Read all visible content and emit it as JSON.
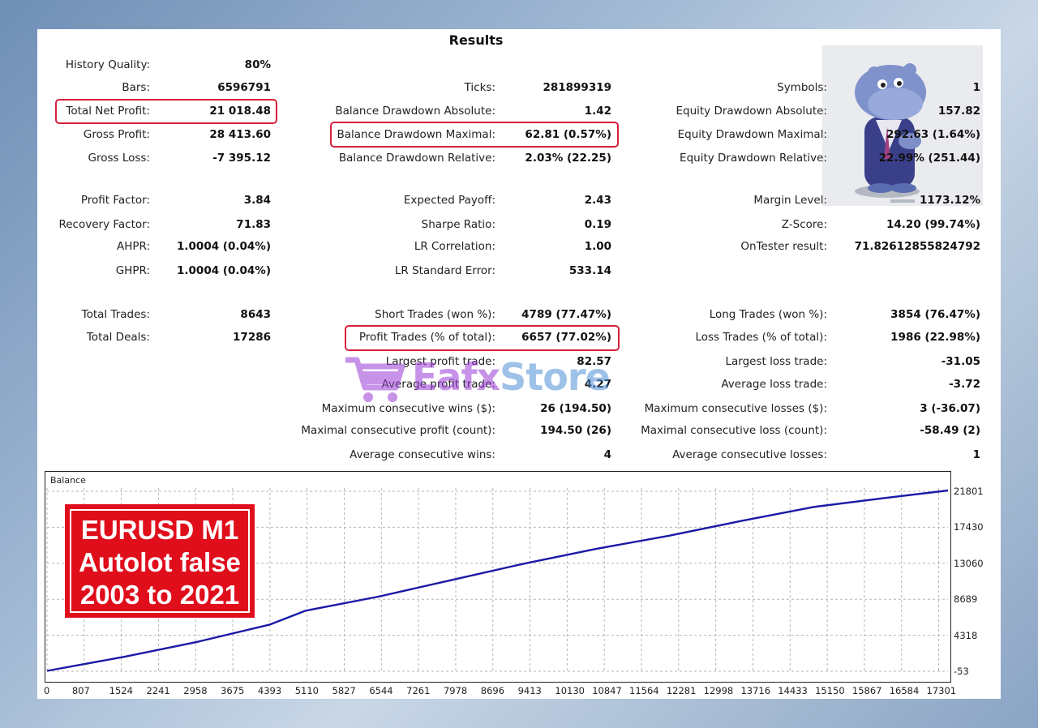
{
  "title": "Results",
  "col1": [
    {
      "label": "History Quality:",
      "value": "80%"
    },
    {
      "label": "Bars:",
      "value": "6596791"
    },
    {
      "label": "Total Net Profit:",
      "value": "21 018.48"
    },
    {
      "label": "Gross Profit:",
      "value": "28 413.60"
    },
    {
      "label": "Gross Loss:",
      "value": "-7 395.12"
    },
    {
      "label": "Profit Factor:",
      "value": "3.84"
    },
    {
      "label": "Recovery Factor:",
      "value": "71.83"
    },
    {
      "label": "AHPR:",
      "value": "1.0004 (0.04%)"
    },
    {
      "label": "GHPR:",
      "value": "1.0004 (0.04%)"
    },
    {
      "label": "Total Trades:",
      "value": "8643"
    },
    {
      "label": "Total Deals:",
      "value": "17286"
    }
  ],
  "col2": [
    {
      "label": "Ticks:",
      "value": "281899319"
    },
    {
      "label": "Balance Drawdown Absolute:",
      "value": "1.42"
    },
    {
      "label": "Balance Drawdown Maximal:",
      "value": "62.81 (0.57%)"
    },
    {
      "label": "Balance Drawdown Relative:",
      "value": "2.03% (22.25)"
    },
    {
      "label": "Expected Payoff:",
      "value": "2.43"
    },
    {
      "label": "Sharpe Ratio:",
      "value": "0.19"
    },
    {
      "label": "LR Correlation:",
      "value": "1.00"
    },
    {
      "label": "LR Standard Error:",
      "value": "533.14"
    },
    {
      "label": "Short Trades (won %):",
      "value": "4789 (77.47%)"
    },
    {
      "label": "Profit Trades (% of total):",
      "value": "6657 (77.02%)"
    },
    {
      "label": "Largest profit trade:",
      "value": "82.57"
    },
    {
      "label": "Average profit trade:",
      "value": "4.27"
    },
    {
      "label": "Maximum consecutive wins ($):",
      "value": "26 (194.50)"
    },
    {
      "label": "Maximal consecutive profit (count):",
      "value": "194.50 (26)"
    },
    {
      "label": "Average consecutive wins:",
      "value": "4"
    }
  ],
  "col3": [
    {
      "label": "Symbols:",
      "value": "1"
    },
    {
      "label": "Equity Drawdown Absolute:",
      "value": "157.82"
    },
    {
      "label": "Equity Drawdown Maximal:",
      "value": "292.63 (1.64%)"
    },
    {
      "label": "Equity Drawdown Relative:",
      "value": "22.99% (251.44)"
    },
    {
      "label": "Margin Level:",
      "value": "1173.12%"
    },
    {
      "label": "Z-Score:",
      "value": "14.20 (99.74%)"
    },
    {
      "label": "OnTester result:",
      "value": "71.82612855824792"
    },
    {
      "label": "Long Trades (won %):",
      "value": "3854 (76.47%)"
    },
    {
      "label": "Loss Trades (% of total):",
      "value": "1986 (22.98%)"
    },
    {
      "label": "Largest loss trade:",
      "value": "-31.05"
    },
    {
      "label": "Average loss trade:",
      "value": "-3.72"
    },
    {
      "label": "Maximum consecutive losses ($):",
      "value": "3 (-36.07)"
    },
    {
      "label": "Maximal consecutive loss (count):",
      "value": "-58.49 (2)"
    },
    {
      "label": "Average consecutive losses:",
      "value": "1"
    }
  ],
  "watermark": {
    "part1": "Eafx",
    "part2": "Store",
    "icon": "shopping-cart-icon"
  },
  "logo": {
    "icon": "hippo-mascot-icon"
  },
  "overlay_lines": [
    "EURUSD M1",
    "Autolot false",
    "2003 to 2021"
  ],
  "colors": {
    "highlight": "#d81f3c",
    "overlay": "#e00d1b",
    "balance_line": "#1a1aa6",
    "grid": "#b5b5b5"
  },
  "chart_data": {
    "type": "line",
    "title": "Balance",
    "xlabel": "",
    "ylabel": "",
    "x_ticks": [
      "0",
      "807",
      "1524",
      "2241",
      "2958",
      "3675",
      "4393",
      "5110",
      "5827",
      "6544",
      "7261",
      "7978",
      "8696",
      "9413",
      "10130",
      "10847",
      "11564",
      "12281",
      "12998",
      "13716",
      "14433",
      "15150",
      "15867",
      "16584",
      "17301"
    ],
    "y_ticks": [
      "21801",
      "17430",
      "13060",
      "8689",
      "4318",
      "-53"
    ],
    "ylim": [
      -53,
      21801
    ],
    "xlim": [
      0,
      17800
    ],
    "grid": true,
    "series": [
      {
        "values_x": [
          0,
          1524,
          2958,
          4393,
          5110,
          6544,
          7978,
          9413,
          10847,
          12281,
          13716,
          15150,
          16584,
          17800
        ],
        "values_y": [
          0,
          1700,
          3500,
          5600,
          7300,
          9000,
          11000,
          13000,
          14800,
          16400,
          18200,
          19900,
          21000,
          21900
        ]
      }
    ]
  }
}
